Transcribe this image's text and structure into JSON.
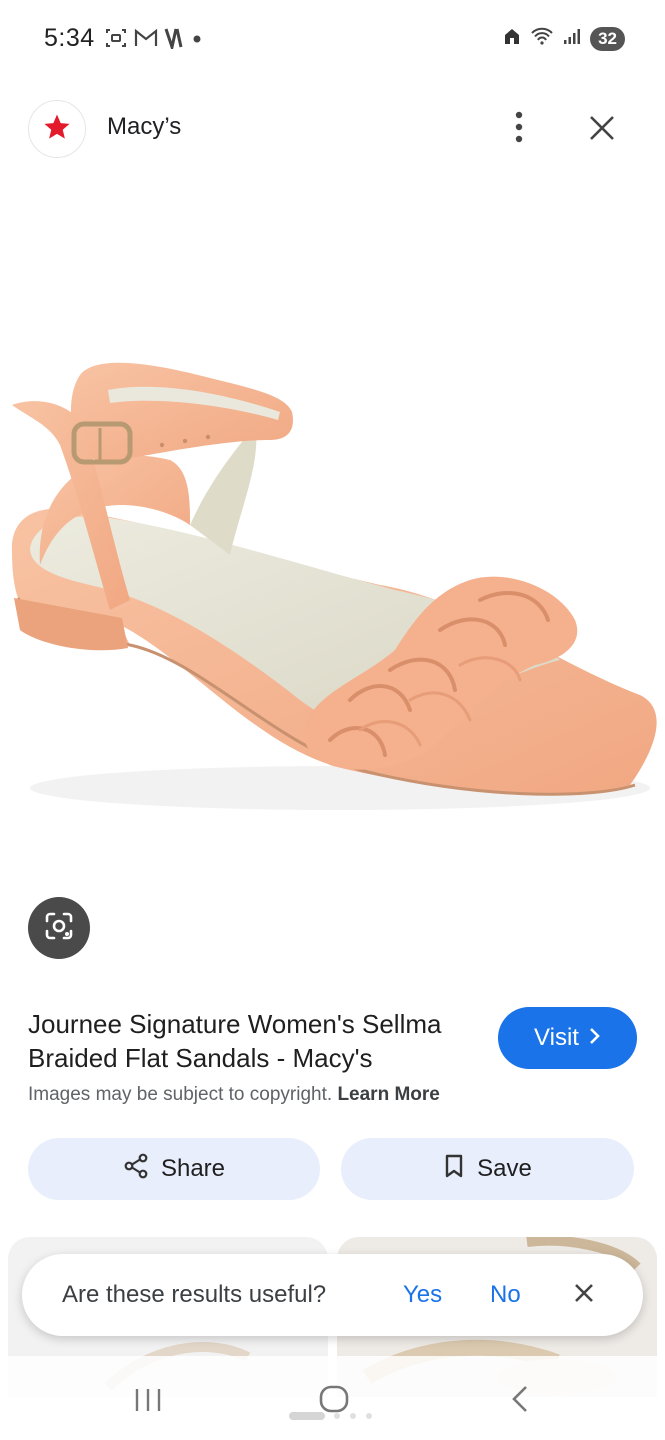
{
  "status_bar": {
    "time": "5:34",
    "battery": "32",
    "left_icons": [
      "screenshot-icon",
      "gmail-icon",
      "v-app-icon",
      "dot-icon"
    ],
    "right_icons": [
      "home-icon",
      "wifi-icon",
      "signal-icon",
      "battery-icon"
    ]
  },
  "header": {
    "site_name": "Macy’s",
    "logo_icon": "star-icon",
    "brand_color": "#e21a2c"
  },
  "image": {
    "subject_icon": "sandal-image"
  },
  "result": {
    "title": "Journee Signature Women's Sellma Braided Flat Sandals - Macy's",
    "visit_label": "Visit",
    "copyright_text": "Images may be subject to copyright.",
    "learn_more_label": "Learn More"
  },
  "actions": {
    "share_label": "Share",
    "save_label": "Save"
  },
  "feedback": {
    "question": "Are these results useful?",
    "yes_label": "Yes",
    "no_label": "No"
  },
  "colors": {
    "accent": "#1a73e8",
    "pill_bg": "#e8eefb",
    "sandal": "#f6b896"
  }
}
